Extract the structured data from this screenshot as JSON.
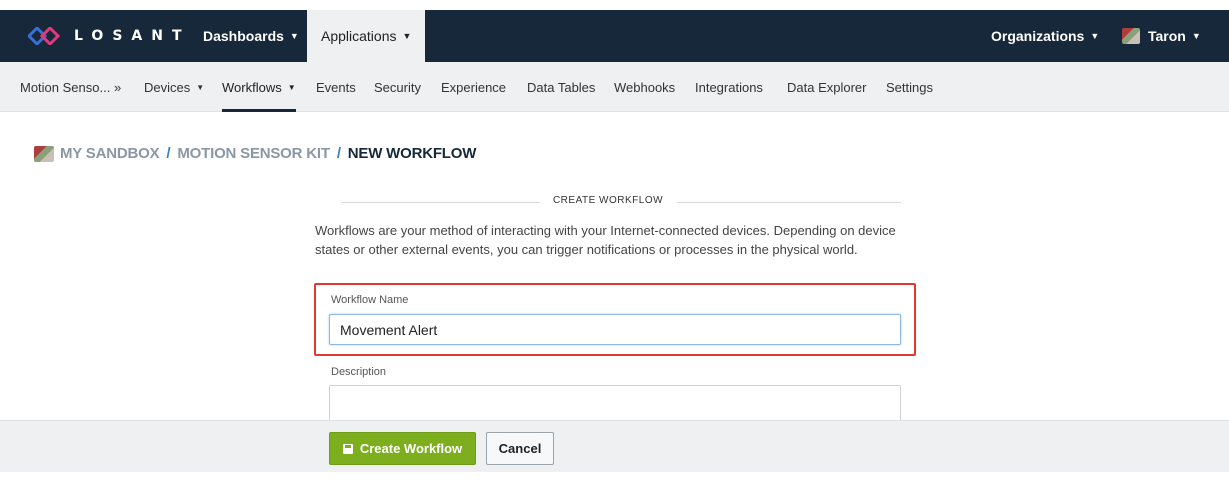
{
  "topnav": {
    "logo_text": "LOSANT",
    "dashboards": "Dashboards",
    "applications": "Applications",
    "organizations": "Organizations",
    "user": "Taron",
    "caret": "▼"
  },
  "subnav": {
    "items": [
      {
        "label": "Motion Senso... »",
        "caret": ""
      },
      {
        "label": "Devices",
        "caret": "▼"
      },
      {
        "label": "Workflows",
        "caret": "▼"
      },
      {
        "label": "Events",
        "caret": ""
      },
      {
        "label": "Security",
        "caret": ""
      },
      {
        "label": "Experience",
        "caret": ""
      },
      {
        "label": "Data Tables",
        "caret": ""
      },
      {
        "label": "Webhooks",
        "caret": ""
      },
      {
        "label": "Integrations",
        "caret": ""
      },
      {
        "label": "Data Explorer",
        "caret": ""
      },
      {
        "label": "Settings",
        "caret": ""
      }
    ]
  },
  "breadcrumb": {
    "items": [
      "MY SANDBOX",
      "MOTION SENSOR KIT",
      "NEW WORKFLOW"
    ],
    "separator": "/"
  },
  "form": {
    "section_title": "CREATE WORKFLOW",
    "description": "Workflows are your method of interacting with your Internet-connected devices. Depending on device states or other external events, you can trigger notifications or processes in the physical world.",
    "name_label": "Workflow Name",
    "name_value": "Movement Alert",
    "description_label": "Description",
    "description_value": ""
  },
  "footer": {
    "create_label": "Create Workflow",
    "cancel_label": "Cancel"
  },
  "colors": {
    "nav_bg": "#17283a",
    "primary": "#7cae1d",
    "highlight": "#e0392f",
    "breadcrumb_sep": "#3b82c4"
  },
  "icons": {
    "logo": "losant-diamond-logo-icon",
    "save": "floppy-save-icon",
    "avatar": "user-avatar"
  }
}
